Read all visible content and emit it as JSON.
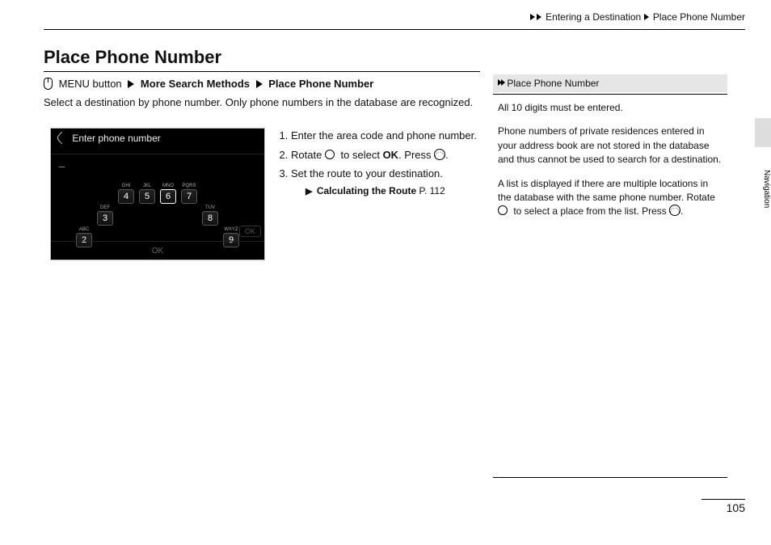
{
  "breadcrumb": {
    "seg1": "Entering a Destination",
    "seg2": "Place Phone Number"
  },
  "title": "Place Phone Number",
  "navsteps": {
    "menu_button": "MENU button",
    "more_search": "More Search Methods",
    "place_phone": "Place Phone Number"
  },
  "intro": "Select a destination by phone number. Only phone numbers in the database are recognized.",
  "device": {
    "header": "Enter phone number",
    "cursor": "_",
    "keys_r1": [
      {
        "ltrs": "GHI",
        "num": "4"
      },
      {
        "ltrs": "JKL",
        "num": "5"
      },
      {
        "ltrs": "MNO",
        "num": "6",
        "sel": true
      },
      {
        "ltrs": "PQRS",
        "num": "7"
      }
    ],
    "keys_r2_left": [
      {
        "ltrs": "ABC",
        "num": "2"
      },
      {
        "ltrs": "DEF",
        "num": "3"
      }
    ],
    "keys_r2_right": [
      {
        "ltrs": "TUV",
        "num": "8"
      },
      {
        "ltrs": "WXYZ",
        "num": "9"
      }
    ],
    "ok": "OK",
    "footer_left": "",
    "footer_center": "OK"
  },
  "steps": {
    "s1": "Enter the area code and phone number.",
    "s2a": "Rotate ",
    "s2b": " to select ",
    "s2_ok": "OK",
    "s2c": ". Press ",
    "s2d": ".",
    "s3": "Set the route to your destination.",
    "xref_label": "Calculating the Route",
    "xref_page": "P. 112"
  },
  "sidebar": {
    "title": "Place Phone Number",
    "p1": "All 10 digits must be entered.",
    "p2": "Phone numbers of private residences entered in your address book are not stored in the database and thus cannot be used to search for a destination.",
    "p3a": "A list is displayed if there are multiple locations in the database with the same phone number. Rotate ",
    "p3b": " to select a place from the list. Press ",
    "p3c": "."
  },
  "tab_label": "Navigation",
  "page_number": "105"
}
